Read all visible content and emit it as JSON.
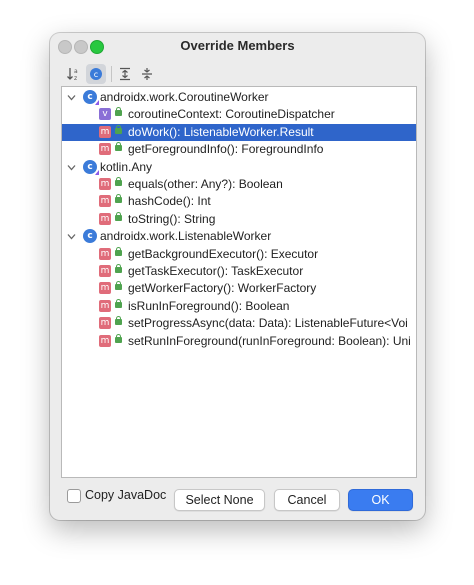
{
  "window": {
    "title": "Override Members"
  },
  "toolbar": {
    "buttons": [
      {
        "name": "sort-alpha-icon",
        "active": false
      },
      {
        "name": "show-classes-icon",
        "active": true
      },
      {
        "name": "expand-all-icon",
        "active": false
      },
      {
        "name": "collapse-all-icon",
        "active": false
      }
    ]
  },
  "tree": {
    "rows": [
      {
        "kind": "class",
        "label": "androidx.work.CoroutineWorker",
        "kotlin": true
      },
      {
        "kind": "val",
        "label": "coroutineContext: CoroutineDispatcher"
      },
      {
        "kind": "method",
        "label": "doWork(): ListenableWorker.Result",
        "selected": true
      },
      {
        "kind": "method",
        "label": "getForegroundInfo(): ForegroundInfo"
      },
      {
        "kind": "class",
        "label": "kotlin.Any",
        "kotlin": true
      },
      {
        "kind": "method",
        "label": "equals(other: Any?): Boolean"
      },
      {
        "kind": "method",
        "label": "hashCode(): Int"
      },
      {
        "kind": "method",
        "label": "toString(): String"
      },
      {
        "kind": "class",
        "label": "androidx.work.ListenableWorker",
        "kotlin": false
      },
      {
        "kind": "method",
        "label": "getBackgroundExecutor(): Executor"
      },
      {
        "kind": "method",
        "label": "getTaskExecutor(): TaskExecutor"
      },
      {
        "kind": "method",
        "label": "getWorkerFactory(): WorkerFactory"
      },
      {
        "kind": "method",
        "label": "isRunInForeground(): Boolean"
      },
      {
        "kind": "method",
        "label": "setProgressAsync(data: Data): ListenableFuture<Voi"
      },
      {
        "kind": "method",
        "label": "setRunInForeground(runInForeground: Boolean): Uni"
      }
    ]
  },
  "footer": {
    "copy_javadoc_label": "Copy JavaDoc",
    "copy_javadoc_checked": false,
    "select_none_label": "Select None",
    "cancel_label": "Cancel",
    "ok_label": "OK"
  },
  "colors": {
    "selection": "#2f65ca",
    "accent": "#3a7cf0",
    "class_icon": "#3b7bd9",
    "method_icon": "#e06c7a",
    "val_icon": "#8a6fd6",
    "lock": "#4fa34f"
  },
  "icon_glyphs": {
    "class": "c",
    "method": "m",
    "val": "v"
  }
}
